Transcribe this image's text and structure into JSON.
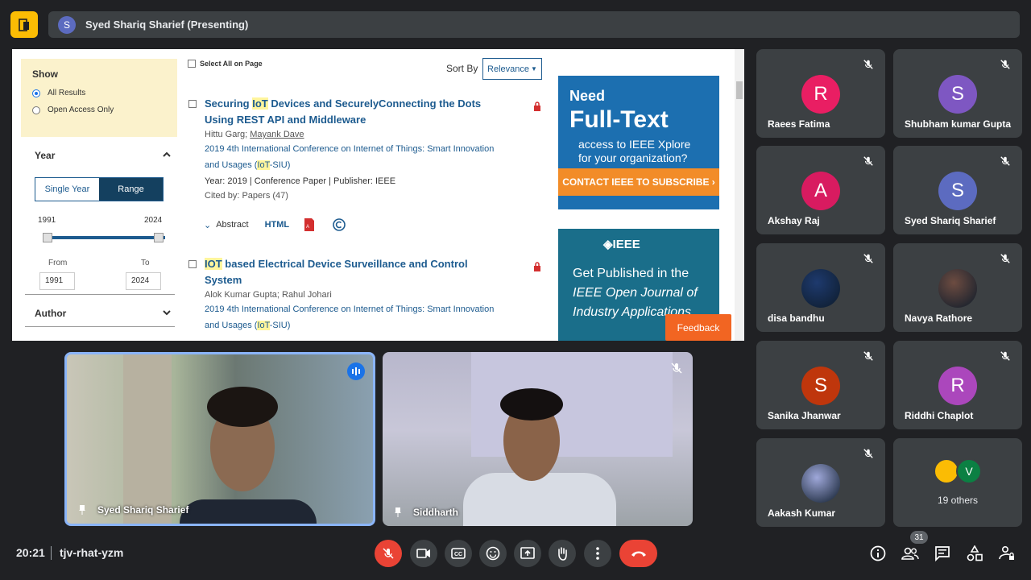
{
  "presenting": {
    "initial": "S",
    "name": "Syed Shariq Sharief (Presenting)"
  },
  "shared_screen": {
    "filters": {
      "show_title": "Show",
      "show_options": [
        "All Results",
        "Open Access Only"
      ],
      "year_title": "Year",
      "year_tabs": [
        "Single Year",
        "Range"
      ],
      "year_min": "1991",
      "year_max": "2024",
      "from_label": "From",
      "to_label": "To",
      "from_value": "1991",
      "to_value": "2024",
      "author_title": "Author"
    },
    "select_all": "Select All on Page",
    "sort_label": "Sort By",
    "sort_value": "Relevance",
    "results": [
      {
        "title_pre": "Securing ",
        "title_hl": "IoT",
        "title_post": " Devices and SecurelyConnecting the Dots",
        "title_line2": "Using REST API and Middleware",
        "author1": "Hittu Garg",
        "author2": "Mayank Dave",
        "venue_line1": "2019 4th International Conference on Internet of Things: Smart Innovation",
        "venue_pre": "and Usages (",
        "venue_hl": "IoT",
        "venue_post": "-SIU)",
        "meta": "Year: 2019  |  Conference Paper  |  Publisher:  IEEE",
        "cited_prefix": "Cited by: ",
        "cited_link": "Papers (47)"
      },
      {
        "title_hl": "IOT",
        "title_post": " based Electrical Device Surveillance and Control",
        "title_line2": "System",
        "author1": "Alok Kumar Gupta",
        "author2": "Rahul Johari",
        "venue_line1": "2019 4th International Conference on Internet of Things: Smart Innovation",
        "venue_pre": "and Usages (",
        "venue_hl": "IoT",
        "venue_post": "-SIU)"
      }
    ],
    "actions": {
      "abstract": "Abstract",
      "html": "HTML"
    },
    "ad1": {
      "line1": "Need",
      "line2": "Full-Text",
      "line3": "access to IEEE Xplore",
      "line4": "for your organization?",
      "cta": "CONTACT IEEE TO SUBSCRIBE ›"
    },
    "ad2": {
      "logo": "◈IEEE",
      "line1": "Get Published in the",
      "line2": "IEEE Open Journal of",
      "line3": "Industry Applications"
    },
    "feedback": "Feedback"
  },
  "main_tiles": [
    {
      "name": "Syed Shariq Sharief"
    },
    {
      "name": "Siddharth"
    }
  ],
  "participants": [
    {
      "initial": "R",
      "name": "Raees Fatima",
      "color": "#e91e63"
    },
    {
      "initial": "S",
      "name": "Shubham kumar Gupta",
      "color": "#7e57c2"
    },
    {
      "initial": "A",
      "name": "Akshay Raj",
      "color": "#d81b60"
    },
    {
      "initial": "S",
      "name": "Syed Shariq Sharief",
      "color": "#5c6bc0"
    },
    {
      "initial": "",
      "name": "disa bandhu",
      "color": "#1e3a6e"
    },
    {
      "initial": "",
      "name": "Navya Rathore",
      "color": "#6d4c41"
    },
    {
      "initial": "S",
      "name": "Sanika Jhanwar",
      "color": "#bf360c"
    },
    {
      "initial": "R",
      "name": "Riddhi Chaplot",
      "color": "#ab47bc"
    },
    {
      "initial": "",
      "name": "Aakash Kumar",
      "color": "#9fa8da"
    }
  ],
  "others": {
    "initial": "V",
    "label": "19 others"
  },
  "bottom": {
    "time": "20:21",
    "code": "tjv-rhat-yzm",
    "people_count": "31"
  },
  "colors": {
    "accent": "#8ab4f8",
    "danger": "#ea4335",
    "tile": "#3c4043",
    "bg": "#202124"
  }
}
